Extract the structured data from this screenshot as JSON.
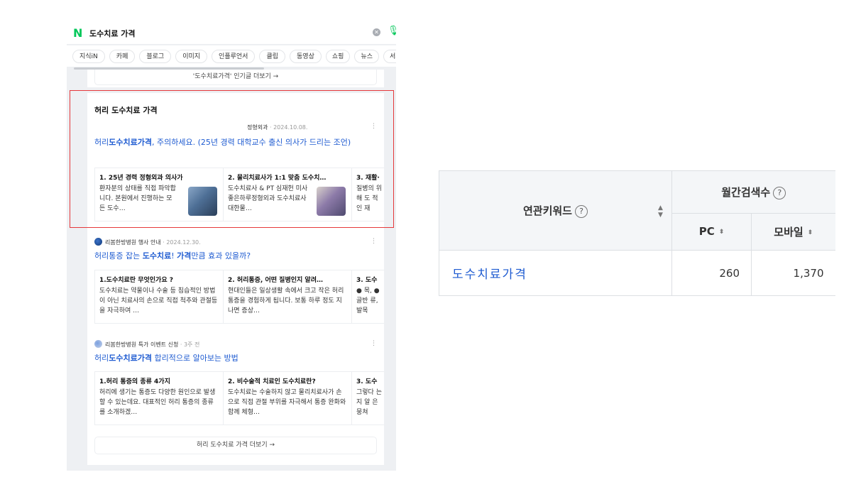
{
  "search": {
    "logo": "N",
    "query": "도수치료 가격"
  },
  "tabs": [
    "지식iN",
    "카페",
    "블로그",
    "이미지",
    "인플루언서",
    "클립",
    "동영상",
    "쇼핑",
    "뉴스",
    "서지"
  ],
  "popular_more": "'도수치료가격' 인기글 더보기 →",
  "section": {
    "title": "허리 도수치료 가격",
    "more": "허리 도수치료 가격 더보기 →"
  },
  "posts": [
    {
      "author": "정형외과",
      "date": "· 2024.10.08.",
      "title_pre": "허리",
      "title_bold": "도수치료가격",
      "title_post": ", 주의하세요. (25년 경력 대학교수 출신 의사가 드리는 조언)",
      "subcards": [
        {
          "title": "1. 25년 경력 정형외과 의사가",
          "body": "환자분의 상태를 직접 파악합니다. 본원에서 진행하는 모든 도수…"
        },
        {
          "title": "2. 물리치료사가 1:1 맞춤 도수치…",
          "body": "도수치료사 & PT 심재헌 미사좋은하루정형외과 도수치료사 대한물…"
        },
        {
          "title": "3. 재활·",
          "body": "질병의 위해 도 적인 재"
        }
      ]
    },
    {
      "author": "리봄한방병원 행사 안내",
      "date": "· 2024.12.30.",
      "title_pre": "허리통증 잡는 ",
      "title_bold": "도수치료",
      "title_mid": "! ",
      "title_bold2": "가격",
      "title_post": "만큼 효과 있을까?",
      "subcards": [
        {
          "title": "1.도수치료란 무엇인가요 ?",
          "body": "도수치료는 약물이나 수술 등 침습적인 방법이 아닌 치료사의 손으로 직접 척추와 관절등을 자극하여 …"
        },
        {
          "title": "2. 허리통증, 어떤 질병인지 알려…",
          "body": "현대인들은 일상생활 속에서 크고 작은 허리 통증을 경험하게 됩니다. 보통 하루 정도 지나면 증상…"
        },
        {
          "title": "3. 도수",
          "body": "● 목, ● 골반 류, 발목"
        }
      ]
    },
    {
      "author": "리봄한방병원 특가 이벤트 신청",
      "date": "· 3주 전",
      "title_pre": "허리",
      "title_bold": "도수치료가격",
      "title_post": " 합리적으로 알아보는 방법",
      "subcards": [
        {
          "title": "1.허리 통증의 종류 4가지",
          "body": "허리에 생기는 통증도 다양한 원인으로 발생할 수 있는데요. 대표적인 허리 통증의 종류를 소개하겠…"
        },
        {
          "title": "2. 비수술적 치료인 도수치료란?",
          "body": "도수치료는 수술하지 않고 물리치료사가 손으로 직접 관절 부위를 자극해서 통증 완화와 함께 체형…"
        },
        {
          "title": "3. 도수",
          "body": "그렇다 는지 알 은 뭉쳐"
        }
      ]
    }
  ],
  "keyword_table": {
    "headers": {
      "keyword": "연관키워드",
      "monthly": "월간검색수",
      "pc": "PC",
      "mobile": "모바일"
    },
    "help_glyph": "?",
    "rows": [
      {
        "keyword": "도수치료가격",
        "pc": "260",
        "mobile": "1,370"
      }
    ]
  },
  "colors": {
    "naver_green": "#03c75a",
    "link_blue": "#1e5bd1",
    "highlight_red": "#e5393b"
  }
}
